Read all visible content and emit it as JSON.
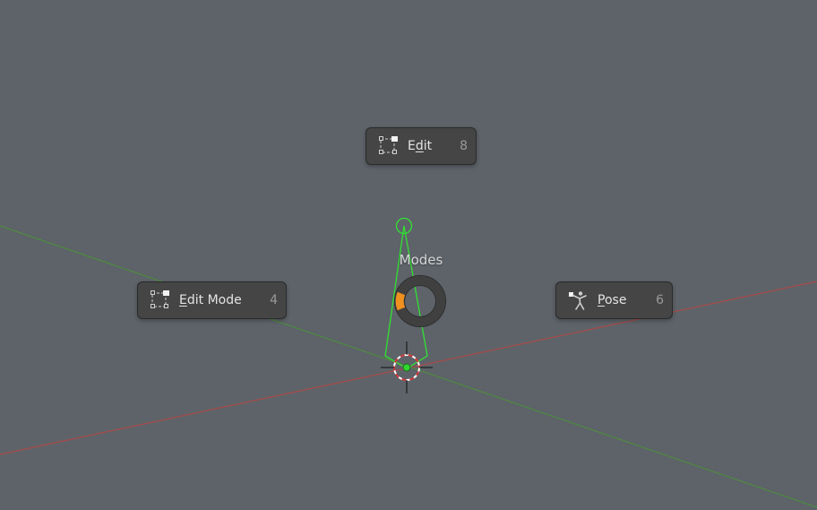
{
  "pie_menu": {
    "title": "Modes",
    "items": [
      {
        "id": "edit",
        "label_pre": "E",
        "label_ul": "d",
        "label_post": "it",
        "shortcut": "8",
        "icon": "edit-mode-icon"
      },
      {
        "id": "edit_mode",
        "label_pre": "",
        "label_ul": "E",
        "label_post": "dit Mode",
        "shortcut": "4",
        "icon": "edit-mode-icon"
      },
      {
        "id": "pose",
        "label_pre": "",
        "label_ul": "P",
        "label_post": "ose",
        "shortcut": "6",
        "icon": "pose-icon"
      }
    ]
  },
  "colors": {
    "background": "#5d6369",
    "x_axis": "#a94a4a",
    "y_axis": "#4f8a3f",
    "bone_outline": "#33e033",
    "pie_direction_indicator": "#f0901e"
  }
}
